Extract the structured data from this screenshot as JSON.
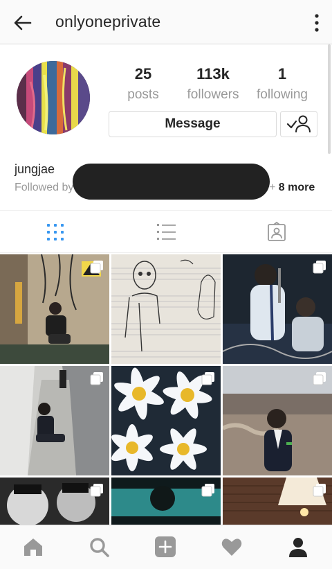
{
  "header": {
    "username": "onlyoneprivate"
  },
  "profile": {
    "stats": [
      {
        "value": "25",
        "label": "posts"
      },
      {
        "value": "113k",
        "label": "followers"
      },
      {
        "value": "1",
        "label": "following"
      }
    ],
    "message_label": "Message",
    "full_name": "jungjae",
    "followed_by_prefix": "Followed by",
    "more_prefix": "+",
    "more_label": "8 more"
  },
  "tabs": [
    "grid-view",
    "list-view",
    "tagged-photos"
  ],
  "grid": {
    "tiles": [
      {
        "desc": "person sitting in warehouse",
        "multi": true
      },
      {
        "desc": "pencil sketch on music paper",
        "multi": false
      },
      {
        "desc": "singer at microphone",
        "multi": true
      },
      {
        "desc": "person crouching in corridor",
        "multi": true
      },
      {
        "desc": "white daisies",
        "multi": true
      },
      {
        "desc": "person in field",
        "multi": true
      },
      {
        "desc": "black and white faces",
        "multi": true
      },
      {
        "desc": "dark teal scene",
        "multi": true
      },
      {
        "desc": "lamp in brick room",
        "multi": true
      }
    ]
  },
  "nav": [
    "home",
    "search",
    "add",
    "activity",
    "profile"
  ],
  "colors": {
    "text": "#262626",
    "muted": "#999999",
    "accent": "#3897f0",
    "border": "#dbdbdb"
  }
}
